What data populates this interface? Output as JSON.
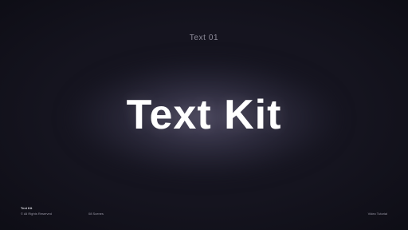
{
  "scene": {
    "background_color": "#15141f",
    "glow_color": "#4e4a62",
    "subtitle": "Text 01",
    "headline": "Text Kit"
  },
  "footer": {
    "brand": "Text Kit",
    "rights": "© All Rights Reserved",
    "count": "08 Scenes",
    "tutorial": "Video Tutorial"
  }
}
